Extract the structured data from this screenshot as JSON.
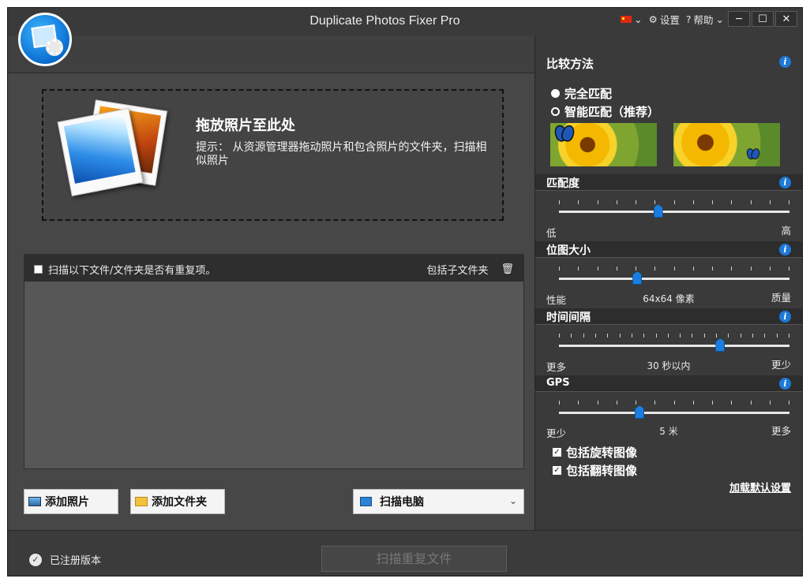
{
  "app": {
    "title": "Duplicate Photos Fixer Pro"
  },
  "title_bar": {
    "language_icon": "china-flag-icon",
    "settings_label": "设置",
    "help_label": "帮助",
    "minimize_icon": "minimize-icon",
    "maximize_icon": "maximize-icon",
    "close_icon": "close-icon",
    "controls": [
      "─",
      "☐",
      "✕"
    ]
  },
  "drop_zone": {
    "title": "拖放照片至此处",
    "hint": "提示： 从资源管理器拖动照片和包含照片的文件夹，扫描相似照片"
  },
  "folder_list": {
    "scan_checkbox_label": "扫描以下文件/文件夹是否有重复项。",
    "scan_checkbox_checked": false,
    "include_subfolders_label": "包括子文件夹",
    "delete_icon": "trash-icon",
    "items": []
  },
  "buttons": {
    "add_photos": "添加照片",
    "add_folder": "添加文件夹",
    "scan_target": "扫描电脑",
    "scan_duplicates": "扫描重复文件"
  },
  "compare": {
    "title": "比较方法",
    "options": [
      {
        "label": "完全匹配",
        "selected": true
      },
      {
        "label": "智能匹配（推荐）",
        "selected": false
      }
    ]
  },
  "sliders": {
    "match_level": {
      "title": "匹配度",
      "left": "低",
      "right": "高",
      "center": "",
      "position": 0.43
    },
    "bitmap_size": {
      "title": "位图大小",
      "left": "性能",
      "right": "质量",
      "center": "64x64 像素",
      "position": 0.34
    },
    "time_interval": {
      "title": "时间间隔",
      "left": "更多",
      "right": "更少",
      "center": "30 秒以内",
      "position": 0.7
    },
    "gps": {
      "title": "GPS",
      "left": "更少",
      "right": "更多",
      "center": "5 米",
      "position": 0.35
    }
  },
  "options": {
    "include_rotated": {
      "label": "包括旋转图像",
      "checked": true
    },
    "include_flipped": {
      "label": "包括翻转图像",
      "checked": true
    }
  },
  "load_defaults": "加载默认设置",
  "footer": {
    "status": "已注册版本"
  },
  "colors": {
    "accent": "#1a7ee0",
    "panel": "#3a3a3a",
    "drop_bg": "#444444"
  }
}
